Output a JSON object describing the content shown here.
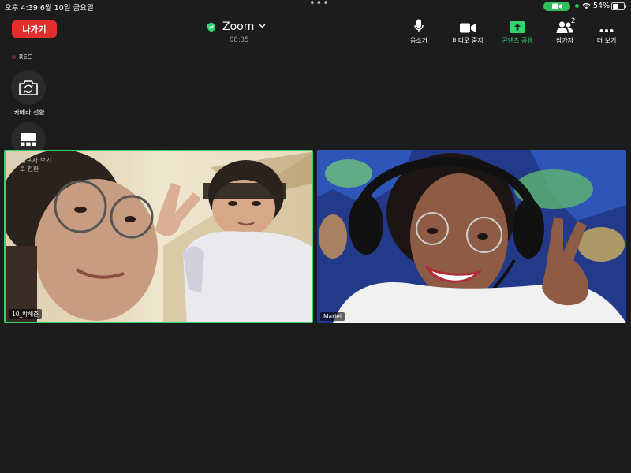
{
  "status_bar": {
    "time_date": "오후 4:39   6월 10일 금요일",
    "battery": "54%"
  },
  "toolbar": {
    "leave_label": "나가기",
    "title": "Zoom",
    "timer": "08:35",
    "tools": [
      {
        "label": "음소거",
        "icon": "microphone-icon"
      },
      {
        "label": "비디오 중지",
        "icon": "video-camera-icon"
      },
      {
        "label": "콘텐츠 공유",
        "icon": "share-arrow-icon"
      },
      {
        "label": "참가자",
        "icon": "participants-icon",
        "badge": "2"
      },
      {
        "label": "더 보기",
        "icon": "more-dots-icon"
      }
    ]
  },
  "left_controls": {
    "rec_label": "REC",
    "camera_switch_label": "카메라 전환",
    "layout_label": "현재 발표자 보기로 전환"
  },
  "participants": [
    {
      "name": "10_박해준",
      "active_speaker": true
    },
    {
      "name": "Mariel",
      "active_speaker": false
    }
  ],
  "colors": {
    "background": "#1c1c1c",
    "leave": "#e22d2d",
    "active_border": "#33d36a",
    "share_green": "#35d26e"
  }
}
